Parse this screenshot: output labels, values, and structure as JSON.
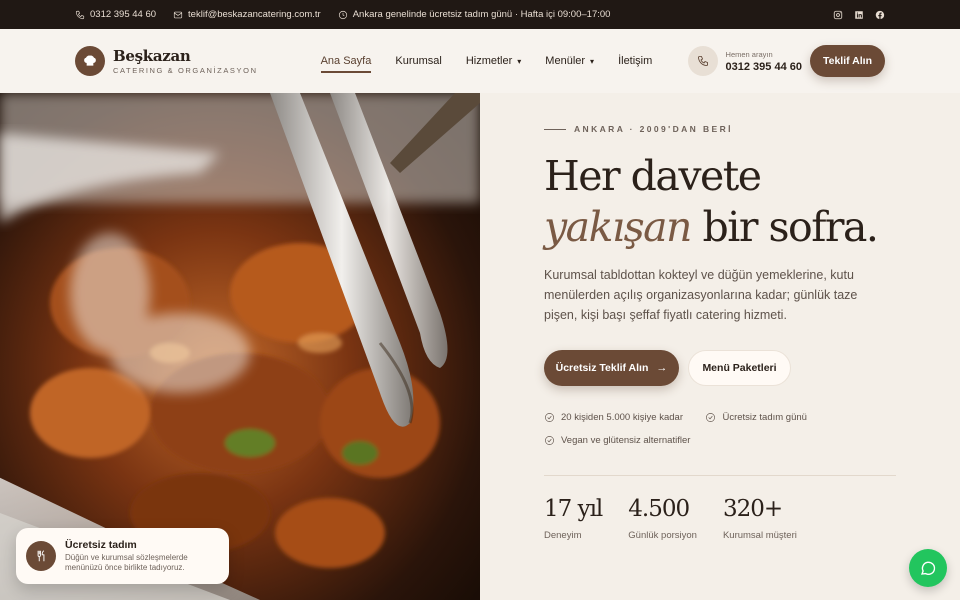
{
  "topbar": {
    "phone": "0312 395 44 60",
    "email": "teklif@beskazancatering.com.tr",
    "hours": "Ankara genelinde ücretsiz tadım günü · Hafta içi 09:00–17:00",
    "social": [
      "instagram-icon",
      "linkedin-icon",
      "facebook-icon"
    ]
  },
  "header": {
    "brand_name": "Beşkazan",
    "brand_tagline": "CATERING & ORGANİZASYON",
    "nav": [
      {
        "label": "Ana Sayfa",
        "active": true
      },
      {
        "label": "Kurumsal"
      },
      {
        "label": "Hizmetler",
        "dropdown": true
      },
      {
        "label": "Menüler",
        "dropdown": true
      },
      {
        "label": "İletişim"
      }
    ],
    "call_label": "Hemen arayın",
    "call_number": "0312 395 44 60",
    "cta_label": "Teklif Alın"
  },
  "hero": {
    "eyebrow": "ANKARA · 2009'DAN BERİ",
    "headline_line1": "Her davete",
    "headline_italic": "yakışan",
    "headline_rest": " bir sofra.",
    "lead": "Kurumsal tabldottan kokteyl ve düğün yemeklerine, kutu menülerden açılış organizasyonlarına kadar; günlük taze pişen, kişi başı şeffaf fiyatlı catering hizmeti.",
    "primary_button": "Ücretsiz Teklif Alın",
    "secondary_button": "Menü Paketleri",
    "features": [
      "20 kişiden 5.000 kişiye kadar",
      "Ücretsiz tadım günü",
      "Vegan ve glütensiz alternatifler"
    ],
    "stats": [
      {
        "value": "17 yıl",
        "label": "Deneyim"
      },
      {
        "value": "4.500",
        "label": "Günlük porsiyon"
      },
      {
        "value": "320+",
        "label": "Kurumsal müşteri"
      }
    ]
  },
  "float_card": {
    "title": "Ücretsiz tadım",
    "description": "Düğün ve kurumsal sözleşmelerde menünüzü önce birlikte tadıyoruz."
  },
  "colors": {
    "brand": "#6b4a36",
    "topbar_bg": "#201814",
    "page_bg": "#f4efe8",
    "whatsapp": "#22c55e"
  }
}
